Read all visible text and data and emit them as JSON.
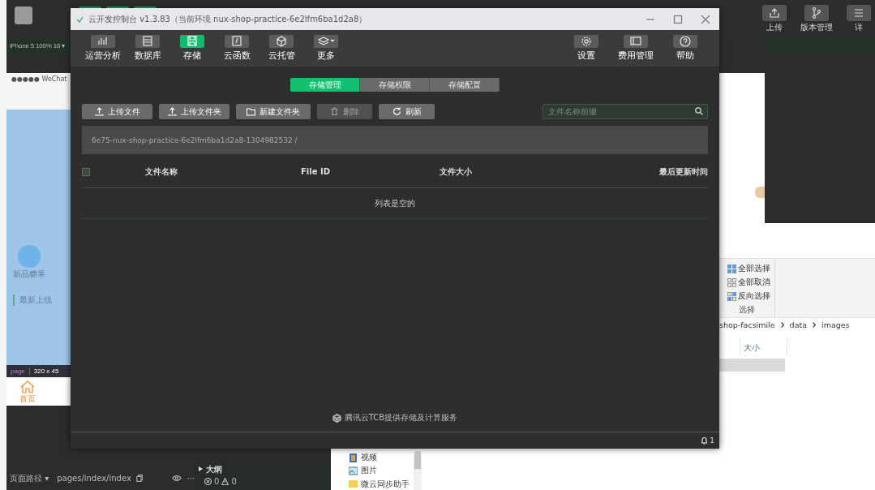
{
  "ide": {
    "device": "iPhone 5 100% 16 ▾",
    "right_tools": [
      {
        "label": "上传"
      },
      {
        "label": "版本管理"
      },
      {
        "label": "详"
      }
    ],
    "bottom_bar": {
      "path_label": "页面路径 ▾",
      "path": "pages/index/index",
      "more": "···",
      "outline": "大纲",
      "errors": "0",
      "warnings": "0"
    }
  },
  "simulator": {
    "status": "●●●●● WeChat",
    "category": "新品糖果",
    "section": "最新上线",
    "inspector": {
      "tag": "page",
      "size": "320 x 45"
    },
    "tabbar": [
      {
        "label": "首页",
        "selected": true
      }
    ]
  },
  "explorer": {
    "ribbon": [
      {
        "label": "全部选择"
      },
      {
        "label": "全部取消"
      },
      {
        "label": "反向选择"
      }
    ],
    "group_label": "选择",
    "breadcrumb": [
      "shop-facsimile",
      "data",
      "images"
    ],
    "column": "大小",
    "nav": [
      {
        "label": "视频"
      },
      {
        "label": "图片"
      },
      {
        "label": "微云同步助手"
      }
    ]
  },
  "console": {
    "title": "云开发控制台 v1.3.83（当前环境 nux-shop-practice-6e2lfm6ba1d2a8）",
    "toolbar": [
      {
        "label": "运营分析",
        "selected": false
      },
      {
        "label": "数据库",
        "selected": false
      },
      {
        "label": "存储",
        "selected": true
      },
      {
        "label": "云函数",
        "selected": false
      },
      {
        "label": "云托管",
        "selected": false
      },
      {
        "label": "更多",
        "selected": false
      }
    ],
    "right_tools": [
      {
        "label": "设置"
      },
      {
        "label": "费用管理"
      },
      {
        "label": "帮助"
      }
    ],
    "tabs": [
      {
        "label": "存储管理",
        "selected": true
      },
      {
        "label": "存储权限",
        "selected": false
      },
      {
        "label": "存储配置",
        "selected": false
      }
    ],
    "actions": [
      {
        "label": "上传文件",
        "disabled": false
      },
      {
        "label": "上传文件夹",
        "disabled": false
      },
      {
        "label": "新建文件夹",
        "disabled": false
      },
      {
        "label": "删除",
        "disabled": true
      },
      {
        "label": "刷新",
        "disabled": false
      }
    ],
    "search": {
      "placeholder": "文件名称前缀"
    },
    "path": "6e75-nux-shop-practice-6e2lfm6ba1d2a8-1304982532 /",
    "select_all": {
      "checked": false
    },
    "columns": [
      "文件名称",
      "File ID",
      "文件大小",
      "最后更新时间"
    ],
    "empty": "列表是空的",
    "footer": "腾讯云TCB提供存储及计算服务",
    "notifications": "1"
  }
}
